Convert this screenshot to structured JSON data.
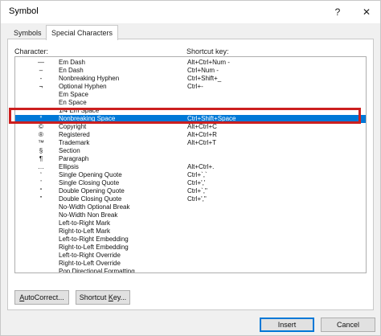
{
  "window": {
    "title": "Symbol",
    "help_glyph": "?",
    "close_glyph": "✕"
  },
  "tabs": [
    {
      "label": "Symbols",
      "active": false
    },
    {
      "label": "Special Characters",
      "active": true
    }
  ],
  "columns": {
    "character": "Character:",
    "shortcut": "Shortcut key:"
  },
  "rows": [
    {
      "char": "—",
      "name": "Em Dash",
      "shortcut": "Alt+Ctrl+Num -"
    },
    {
      "char": "–",
      "name": "En Dash",
      "shortcut": "Ctrl+Num -"
    },
    {
      "char": "-",
      "name": "Nonbreaking Hyphen",
      "shortcut": "Ctrl+Shift+_"
    },
    {
      "char": "¬",
      "name": "Optional Hyphen",
      "shortcut": "Ctrl+-"
    },
    {
      "char": "",
      "name": "Em Space",
      "shortcut": ""
    },
    {
      "char": "",
      "name": "En Space",
      "shortcut": ""
    },
    {
      "char": "",
      "name": "1/4 Em Space",
      "shortcut": ""
    },
    {
      "char": "°",
      "name": "Nonbreaking Space",
      "shortcut": "Ctrl+Shift+Space",
      "selected": true
    },
    {
      "char": "©",
      "name": "Copyright",
      "shortcut": "Alt+Ctrl+C"
    },
    {
      "char": "®",
      "name": "Registered",
      "shortcut": "Alt+Ctrl+R"
    },
    {
      "char": "™",
      "name": "Trademark",
      "shortcut": "Alt+Ctrl+T"
    },
    {
      "char": "§",
      "name": "Section",
      "shortcut": ""
    },
    {
      "char": "¶",
      "name": "Paragraph",
      "shortcut": ""
    },
    {
      "char": "…",
      "name": "Ellipsis",
      "shortcut": "Alt+Ctrl+."
    },
    {
      "char": "‘",
      "name": "Single Opening Quote",
      "shortcut": "Ctrl+`,`"
    },
    {
      "char": "’",
      "name": "Single Closing Quote",
      "shortcut": "Ctrl+','"
    },
    {
      "char": "“",
      "name": "Double Opening Quote",
      "shortcut": "Ctrl+`,\""
    },
    {
      "char": "”",
      "name": "Double Closing Quote",
      "shortcut": "Ctrl+',\""
    },
    {
      "char": "",
      "name": "No-Width Optional Break",
      "shortcut": ""
    },
    {
      "char": "",
      "name": "No-Width Non Break",
      "shortcut": ""
    },
    {
      "char": "",
      "name": "Left-to-Right Mark",
      "shortcut": ""
    },
    {
      "char": "",
      "name": "Right-to-Left Mark",
      "shortcut": ""
    },
    {
      "char": "",
      "name": "Left-to-Right Embedding",
      "shortcut": ""
    },
    {
      "char": "",
      "name": "Right-to-Left Embedding",
      "shortcut": ""
    },
    {
      "char": "",
      "name": "Left-to-Right Override",
      "shortcut": ""
    },
    {
      "char": "",
      "name": "Right-to-Left Override",
      "shortcut": ""
    },
    {
      "char": "",
      "name": "Pop Directional Formatting",
      "shortcut": ""
    }
  ],
  "buttons": {
    "autocorrect": {
      "underlined": "A",
      "rest": "utoCorrect..."
    },
    "shortcut": {
      "before": "Shortcut ",
      "underlined": "K",
      "after": "ey..."
    },
    "insert": "Insert",
    "cancel": "Cancel"
  },
  "colors": {
    "selection": "#0078d7",
    "highlight_frame": "#cc1f1f"
  }
}
